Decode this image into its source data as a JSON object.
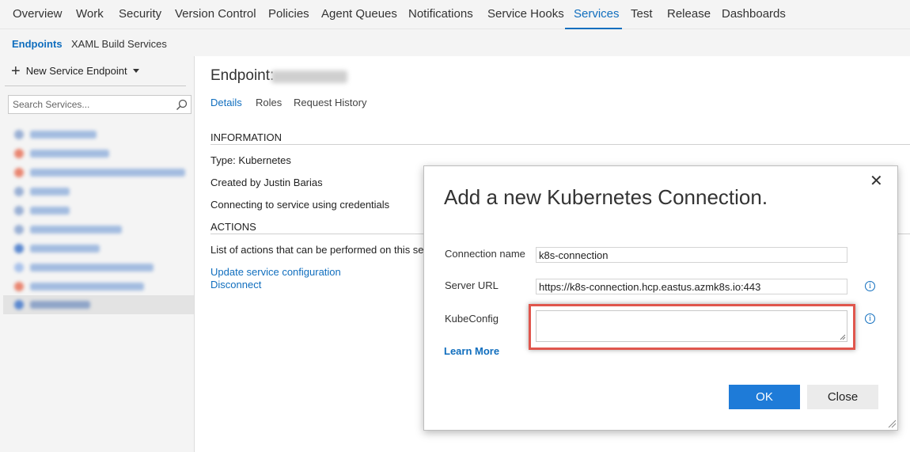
{
  "topnav": {
    "tabs": [
      "Overview",
      "Work",
      "Security",
      "Version Control",
      "Policies",
      "Agent Queues",
      "Notifications",
      "Service Hooks",
      "Services",
      "Test",
      "Release",
      "Dashboards"
    ],
    "active": "Services"
  },
  "subnav": {
    "endpoints": "Endpoints",
    "xaml": "XAML Build Services"
  },
  "sidebar": {
    "new_endpoint": "New Service Endpoint",
    "search_placeholder": "Search Services..."
  },
  "main": {
    "endpoint_label": "Endpoint:",
    "tabs": {
      "details": "Details",
      "roles": "Roles",
      "history": "Request History"
    },
    "information_heading": "INFORMATION",
    "type_line": "Type: Kubernetes",
    "created_line": "Created by Justin Barias",
    "connecting_line": "Connecting to service using credentials",
    "actions_heading": "ACTIONS",
    "actions_desc": "List of actions that can be performed on this service",
    "update_link": "Update service configuration",
    "disconnect_link": "Disconnect"
  },
  "dialog": {
    "title": "Add a new Kubernetes Connection.",
    "connection_name_label": "Connection name",
    "connection_name_value": "k8s-connection",
    "server_url_label": "Server URL",
    "server_url_value": "https://k8s-connection.hcp.eastus.azmk8s.io:443",
    "kubeconfig_label": "KubeConfig",
    "learn_more": "Learn More",
    "ok": "OK",
    "close": "Close",
    "info_glyph": "i",
    "close_glyph": "✕"
  },
  "colors": {
    "accent": "#106ebe",
    "primary_button": "#1e7bd8",
    "highlight": "#e0564d"
  }
}
